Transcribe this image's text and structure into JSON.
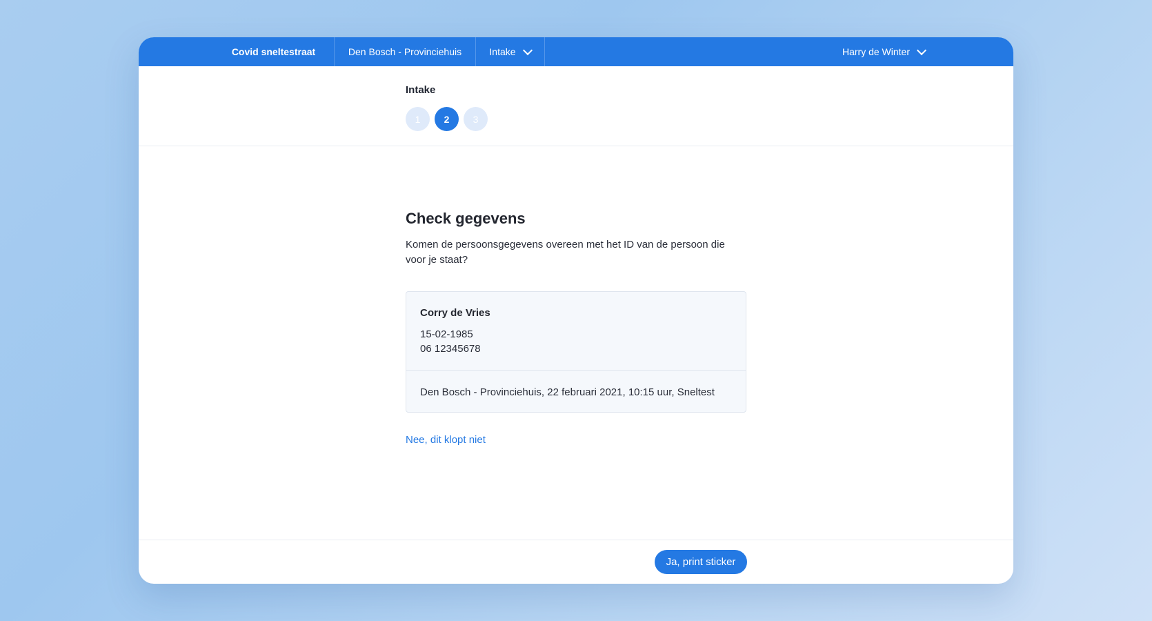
{
  "nav": {
    "app_name": "Covid sneltestraat",
    "location": "Den Bosch - Provinciehuis",
    "step_menu": "Intake",
    "user": "Harry de Winter"
  },
  "header": {
    "title": "Intake",
    "steps": [
      {
        "label": "1",
        "state": "inactive"
      },
      {
        "label": "2",
        "state": "active"
      },
      {
        "label": "3",
        "state": "inactive"
      }
    ]
  },
  "main": {
    "heading": "Check gegevens",
    "description": "Komen de persoonsgegevens overeen met het ID van de persoon die voor je staat?",
    "person": {
      "name": "Corry de Vries",
      "birthdate": "15-02-1985",
      "phone": "06 12345678"
    },
    "appointment": "Den Bosch - Provinciehuis, 22 februari 2021, 10:15 uur, Sneltest",
    "deny_link": "Nee, dit klopt niet"
  },
  "footer": {
    "confirm_button": "Ja, print sticker"
  },
  "colors": {
    "accent": "#2479e3",
    "step_inactive": "#dfeafa",
    "card_background": "#f5f8fc"
  }
}
